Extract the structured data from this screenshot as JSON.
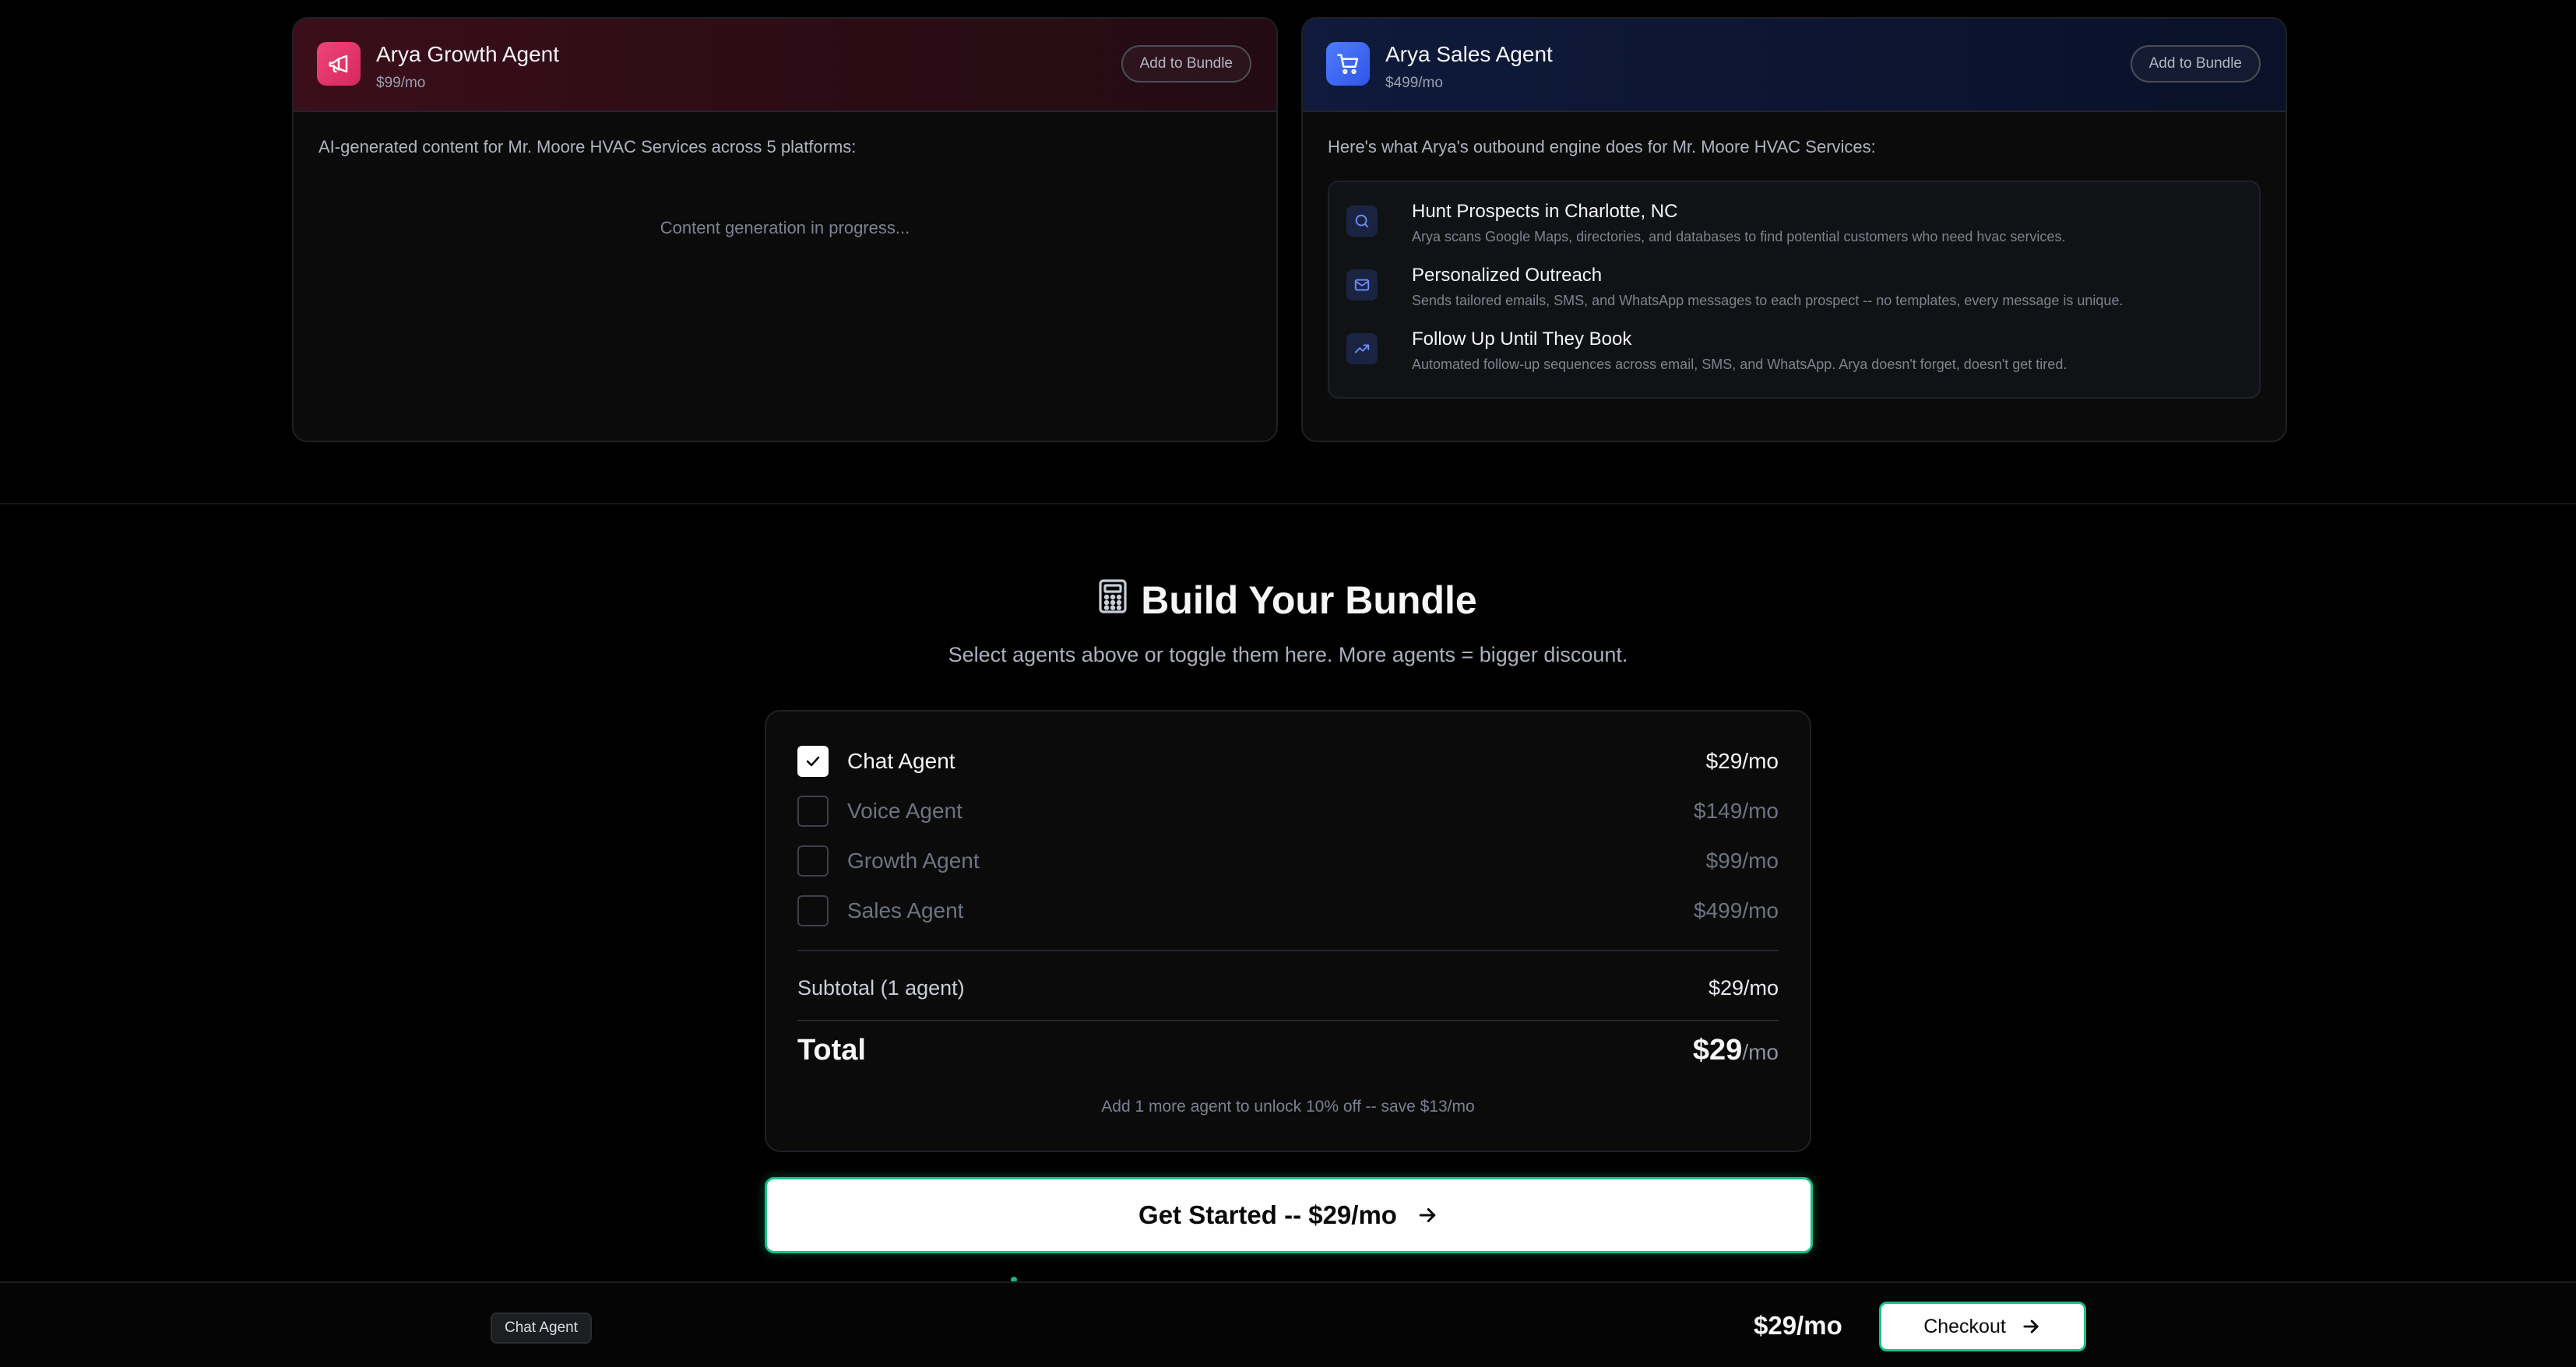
{
  "growth_card": {
    "title": "Arya Growth Agent",
    "price": "$99/mo",
    "add_button": "Add to Bundle",
    "intro": "AI-generated content for Mr. Moore HVAC Services across 5 platforms:",
    "progress": "Content generation in progress...",
    "icon": "megaphone-icon",
    "accent": "#e8336d"
  },
  "sales_card": {
    "title": "Arya Sales Agent",
    "price": "$499/mo",
    "add_button": "Add to Bundle",
    "intro": "Here's what Arya's outbound engine does for Mr. Moore HVAC Services:",
    "icon": "cart-icon",
    "accent": "#4169f5",
    "steps": [
      {
        "title": "Hunt Prospects in Charlotte, NC",
        "desc": "Arya scans Google Maps, directories, and databases to find potential customers who need hvac services.",
        "icon": "search-icon"
      },
      {
        "title": "Personalized Outreach",
        "desc": "Sends tailored emails, SMS, and WhatsApp messages to each prospect -- no templates, every message is unique.",
        "icon": "mail-icon"
      },
      {
        "title": "Follow Up Until They Book",
        "desc": "Automated follow-up sequences across email, SMS, and WhatsApp. Arya doesn't forget, doesn't get tired.",
        "icon": "trending-up-icon"
      }
    ]
  },
  "bundle": {
    "title": "Build Your Bundle",
    "subtitle": "Select agents above or toggle them here. More agents = bigger discount.",
    "icon": "calculator-icon",
    "agents": [
      {
        "label": "Chat Agent",
        "price": "$29/mo",
        "checked": true
      },
      {
        "label": "Voice Agent",
        "price": "$149/mo",
        "checked": false
      },
      {
        "label": "Growth Agent",
        "price": "$99/mo",
        "checked": false
      },
      {
        "label": "Sales Agent",
        "price": "$499/mo",
        "checked": false
      }
    ],
    "subtotal_label": "Subtotal (1 agent)",
    "subtotal_value": "$29/mo",
    "total_label": "Total",
    "total_amount": "$29",
    "total_per": "/mo",
    "unlock_note": "Add 1 more agent to unlock 10% off -- save $13/mo",
    "cta_label": "Get Started -- $29/mo"
  },
  "bottom_bar": {
    "chip": "Chat Agent",
    "price": "$29/mo",
    "checkout_label": "Checkout",
    "cta_border": "#18c28a"
  }
}
